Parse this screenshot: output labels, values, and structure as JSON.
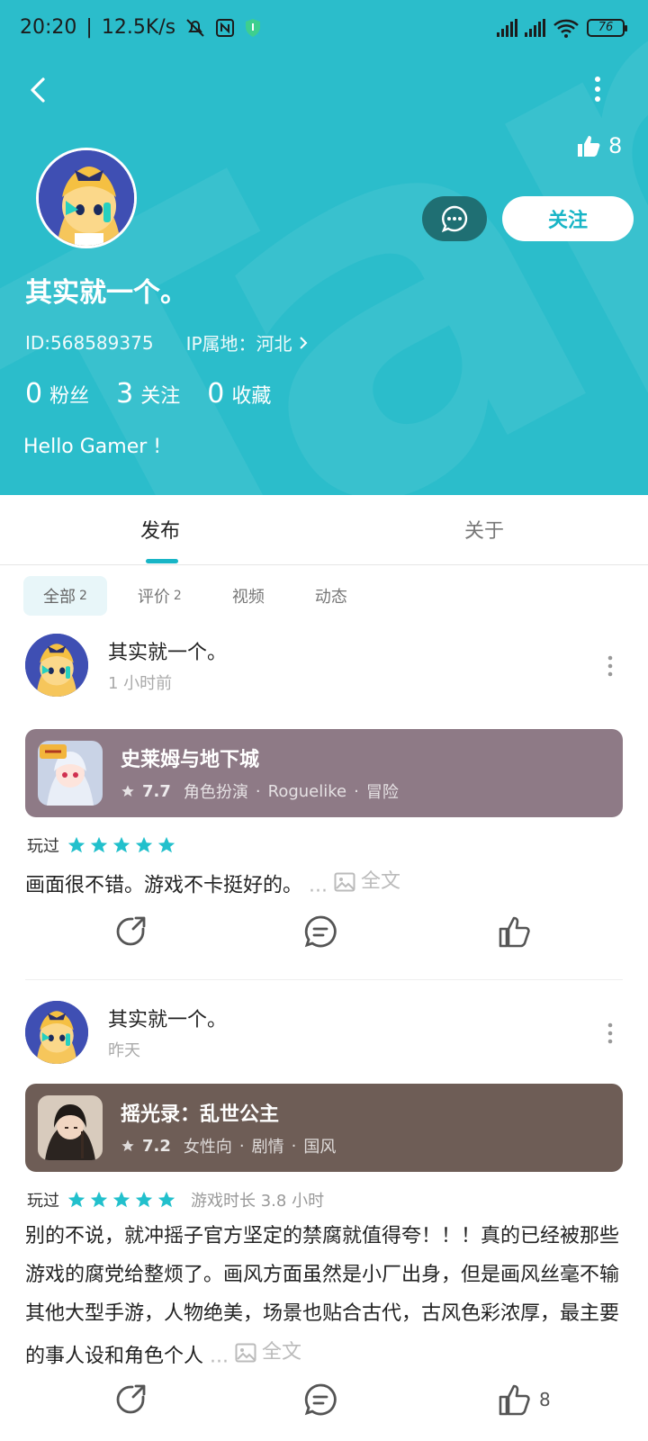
{
  "status_bar": {
    "time": "20:20",
    "speed": "12.5K/s",
    "battery": "76"
  },
  "profile": {
    "like_count": "8",
    "username": "其实就一个。",
    "id_text": "ID:568589375",
    "ip_text": "IP属地：河北",
    "follow_label": "关注",
    "stats": [
      {
        "num": "0",
        "label": "粉丝"
      },
      {
        "num": "3",
        "label": "关注"
      },
      {
        "num": "0",
        "label": "收藏"
      }
    ],
    "bio": "Hello Gamer !"
  },
  "tabs": [
    "发布",
    "关于"
  ],
  "filters": [
    {
      "label": "全部",
      "count": "2"
    },
    {
      "label": "评价",
      "count": "2"
    },
    {
      "label": "视频",
      "count": ""
    },
    {
      "label": "动态",
      "count": ""
    }
  ],
  "posts": [
    {
      "author": "其实就一个。",
      "time": "1 小时前",
      "game": {
        "title": "史莱姆与地下城",
        "score": "7.7",
        "tags": [
          "角色扮演",
          "Roguelike",
          "冒险"
        ],
        "card_color": "#8e7a86"
      },
      "played_label": "玩过",
      "rating": 5,
      "playtime": "",
      "review": "画面很不错。游戏不卡挺好的。",
      "more_dots": "...",
      "fulltext_label": "全文",
      "like_count": ""
    },
    {
      "author": "其实就一个。",
      "time": "昨天",
      "game": {
        "title": "摇光录：乱世公主",
        "score": "7.2",
        "tags": [
          "女性向",
          "剧情",
          "国风"
        ],
        "card_color": "#6e5d56"
      },
      "played_label": "玩过",
      "rating": 5,
      "playtime": "游戏时长 3.8 小时",
      "review": "别的不说，就冲摇子官方坚定的禁腐就值得夸！！！真的已经被那些游戏的腐党给整烦了。画风方面虽然是小厂出身，但是画风丝毫不输其他大型手游，人物绝美，场景也贴合古代，古风色彩浓厚，最主要的事人设和角色个人",
      "more_dots": "...",
      "fulltext_label": "全文",
      "like_count": "8"
    }
  ],
  "colors": {
    "header_bg": "#2bbdcb",
    "accent": "#18b5c6",
    "chat_btn": "#1f6f73"
  }
}
